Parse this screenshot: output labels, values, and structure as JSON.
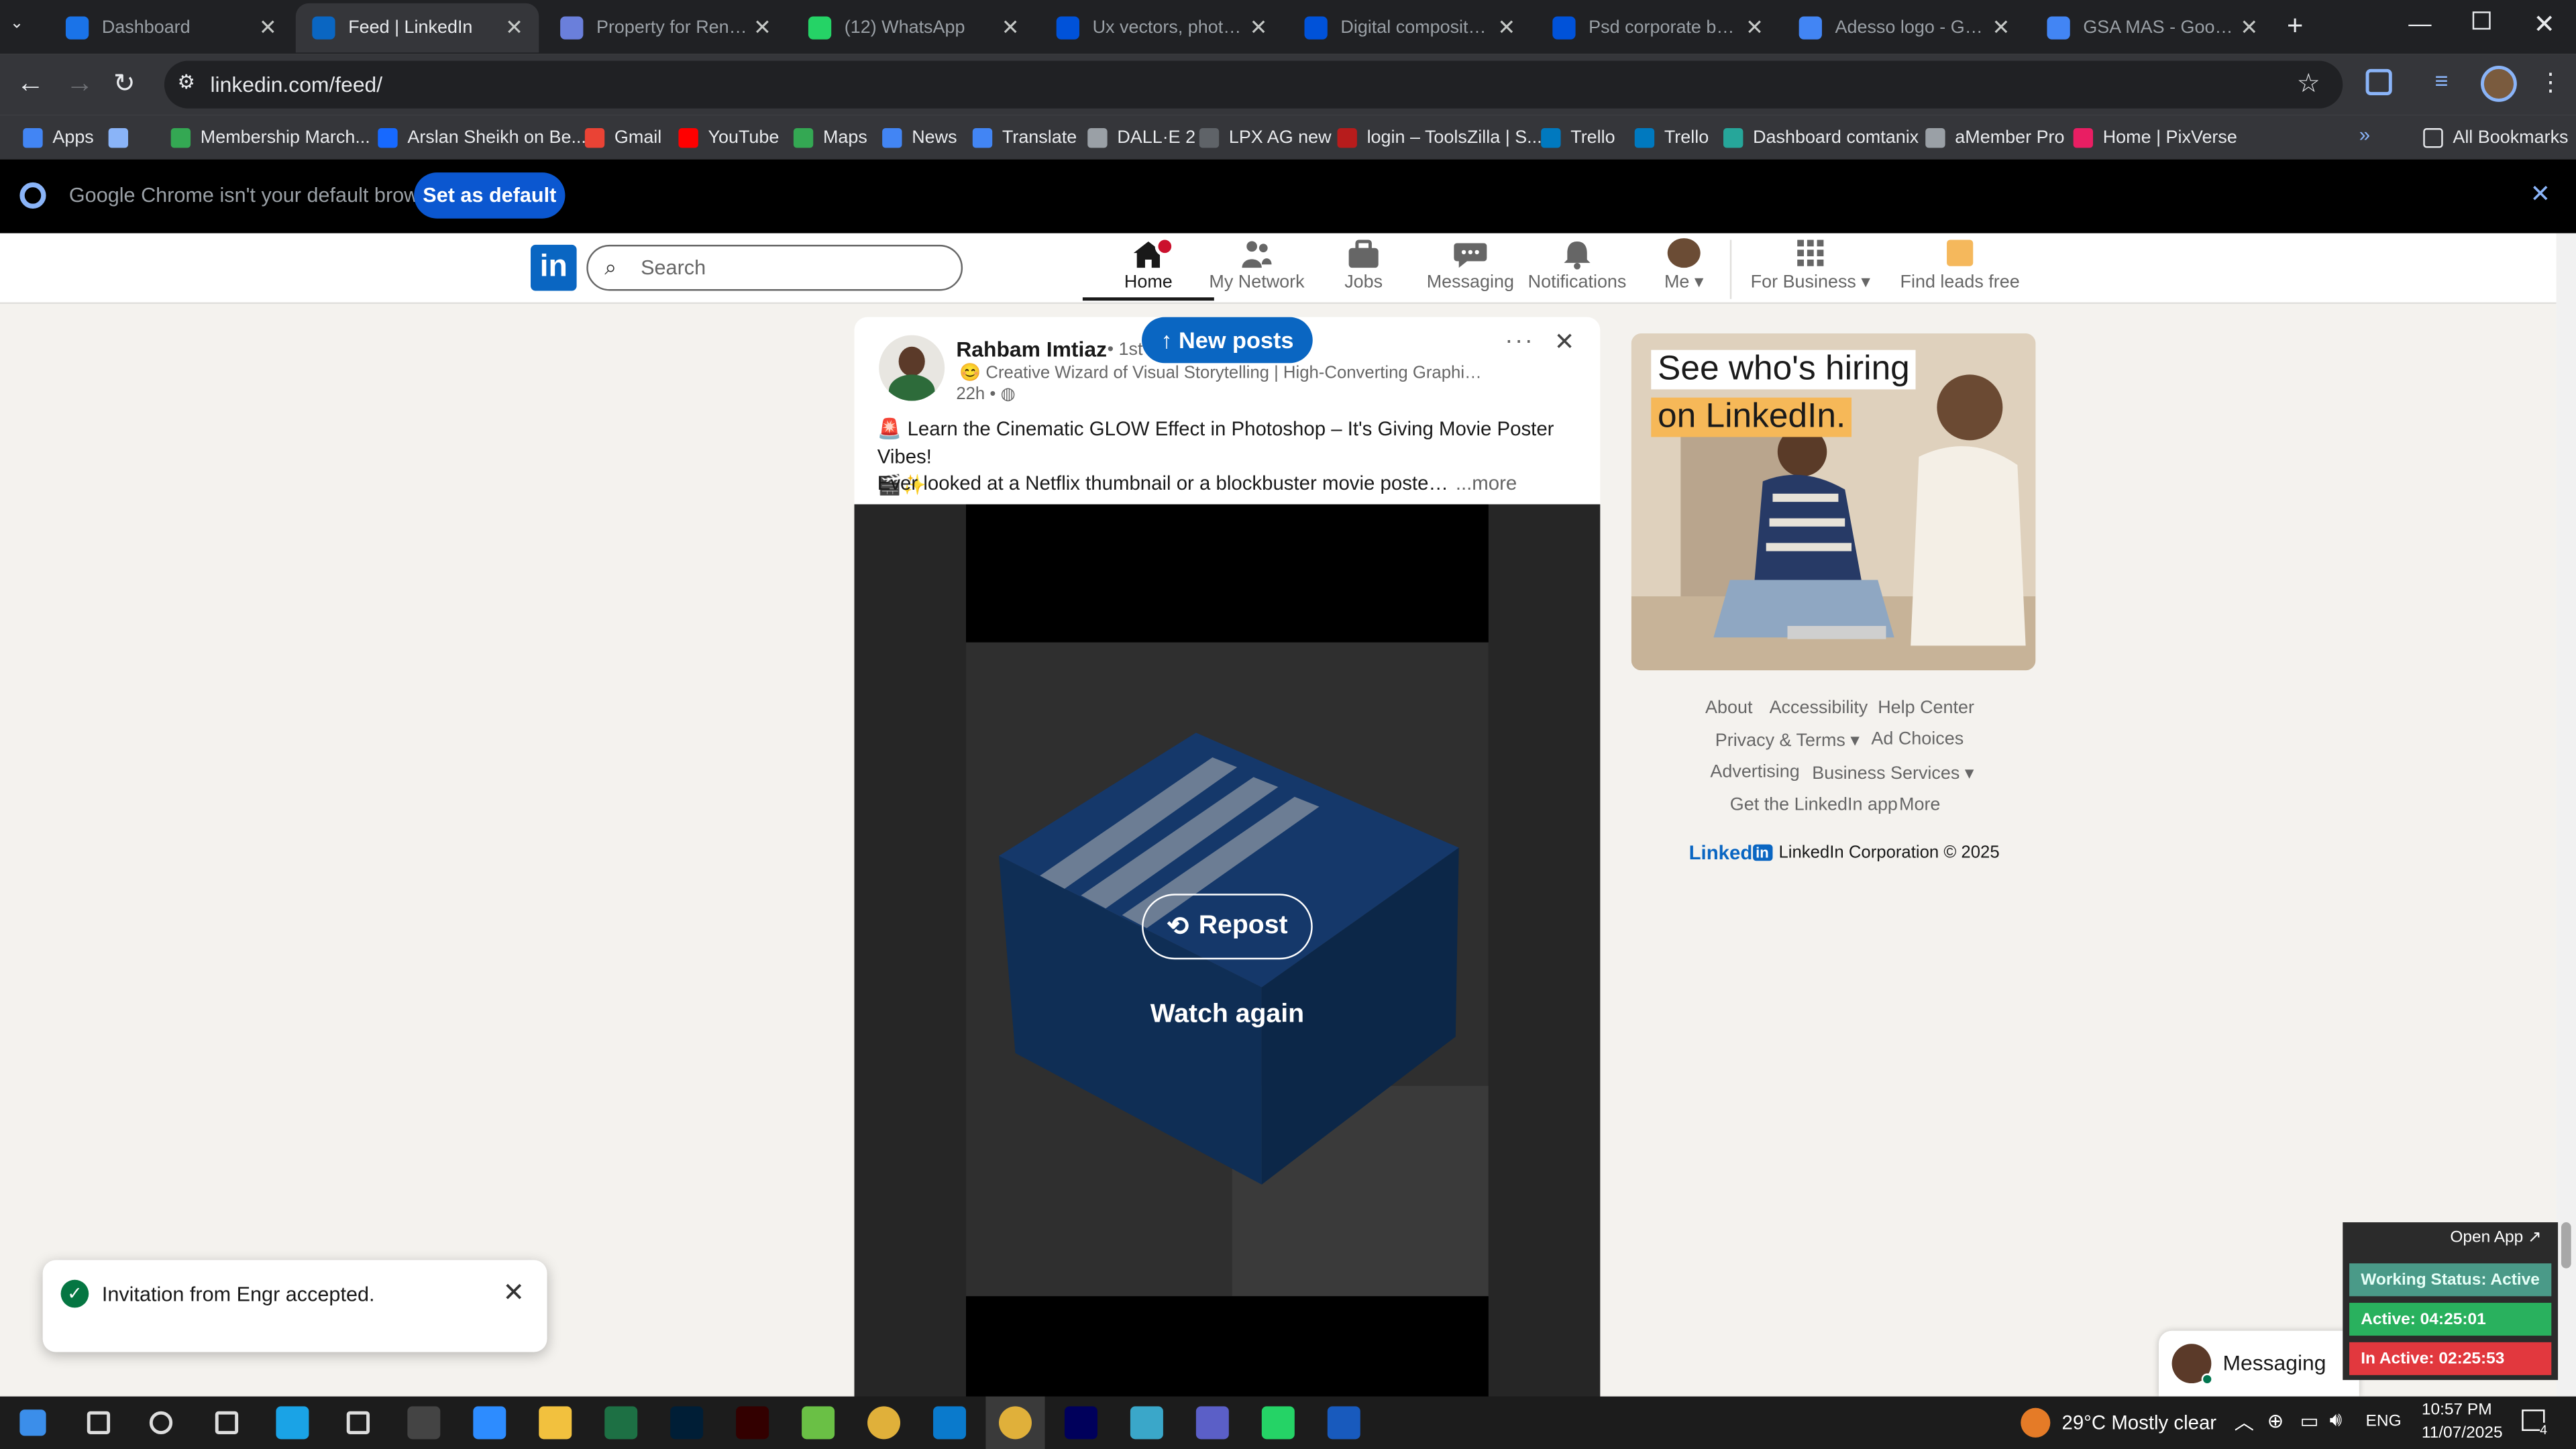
{
  "tabs": [
    {
      "title": "Dashboard",
      "color": "#1a73e8"
    },
    {
      "title": "Feed | LinkedIn",
      "color": "#0a66c2"
    },
    {
      "title": "Property for Rent in P",
      "color": "#6a7fdb"
    },
    {
      "title": "(12) WhatsApp",
      "color": "#25d366"
    },
    {
      "title": "Ux vectors, photos an",
      "color": "#0052d9"
    },
    {
      "title": "Digital composite im",
      "color": "#0052d9"
    },
    {
      "title": "Psd corporate busine",
      "color": "#0052d9"
    },
    {
      "title": "Adesso logo - Googl",
      "color": "#4285f4"
    },
    {
      "title": "GSA MAS - Google S",
      "color": "#4285f4"
    }
  ],
  "address": "linkedin.com/feed/",
  "bookmarks": [
    {
      "label": "Apps",
      "color": "#4285f4"
    },
    {
      "label": "",
      "color": "#8ab4f8"
    },
    {
      "label": "Membership March...",
      "color": "#34a853"
    },
    {
      "label": "Arslan Sheikh on Be...",
      "color": "#1769ff"
    },
    {
      "label": "Gmail",
      "color": "#ea4335"
    },
    {
      "label": "YouTube",
      "color": "#ff0000"
    },
    {
      "label": "Maps",
      "color": "#34a853"
    },
    {
      "label": "News",
      "color": "#4285f4"
    },
    {
      "label": "Translate",
      "color": "#4285f4"
    },
    {
      "label": "DALL·E 2",
      "color": "#9aa0a6"
    },
    {
      "label": "LPX AG new",
      "color": "#5f6368"
    },
    {
      "label": "login – ToolsZilla | S...",
      "color": "#b71c1c"
    },
    {
      "label": "Trello",
      "color": "#0079bf"
    },
    {
      "label": "Trello",
      "color": "#0079bf"
    },
    {
      "label": "Dashboard comtanix",
      "color": "#26a69a"
    },
    {
      "label": "aMember Pro",
      "color": "#9aa0a6"
    },
    {
      "label": "Home | PixVerse",
      "color": "#e91e63"
    }
  ],
  "all_bookmarks": "All Bookmarks",
  "infobar": {
    "message": "Google Chrome isn't your default browser",
    "button": "Set as default"
  },
  "nav": {
    "search_placeholder": "Search",
    "items": [
      "Home",
      "My Network",
      "Jobs",
      "Messaging",
      "Notifications",
      "Me",
      "For Business",
      "Find leads free"
    ]
  },
  "post": {
    "author": "Rahbam Imtiaz",
    "degree": "• 1st",
    "headline": "Creative Wizard of Visual Storytelling | High-Converting Graphic Des...",
    "time": "22h •",
    "text1": "Learn the Cinematic GLOW Effect in Photoshop – It's Giving Movie Poster Vibes!",
    "text2": "Ever looked at a Netflix thumbnail or a blockbuster movie poster and",
    "more": "...more",
    "new_posts": "New posts",
    "repost": "Repost",
    "watch_again": "Watch again"
  },
  "ad": {
    "line1": "See who's hiring",
    "line2": "on LinkedIn."
  },
  "footer": {
    "about": "About",
    "accessibility": "Accessibility",
    "help": "Help Center",
    "privacy": "Privacy & Terms",
    "adchoices": "Ad Choices",
    "advertising": "Advertising",
    "business": "Business Services",
    "getapp": "Get the LinkedIn app",
    "more": "More",
    "brand": "Linked",
    "copyright": "LinkedIn Corporation © 2025"
  },
  "toast": {
    "message": "Invitation from Engr accepted."
  },
  "messaging": "Messaging",
  "tracker": {
    "open": "Open App ↗",
    "status": "Working Status: Active",
    "active": "Active: 04:25:01",
    "inactive": "In Active: 02:25:53"
  },
  "taskbar": {
    "weather": "29°C  Mostly clear",
    "lang": "ENG",
    "time": "10:57 PM",
    "date": "11/07/2025",
    "notif": "4"
  }
}
